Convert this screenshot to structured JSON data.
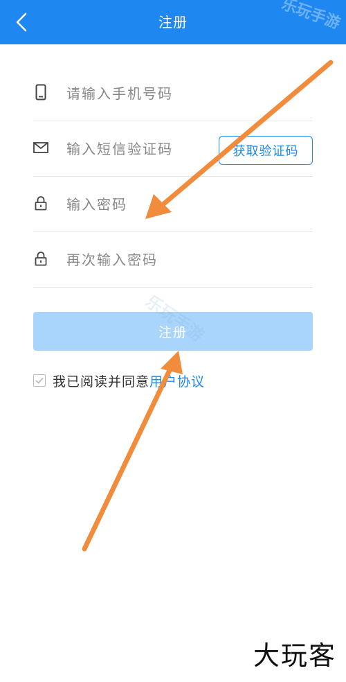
{
  "header": {
    "title": "注册",
    "watermark": "乐玩手游"
  },
  "form": {
    "phone": {
      "placeholder": "请输入手机号码",
      "icon": "phone-icon"
    },
    "sms": {
      "placeholder": "输入短信验证码",
      "icon": "mail-icon",
      "button_label": "获取验证码"
    },
    "password": {
      "placeholder": "输入密码",
      "icon": "lock-icon"
    },
    "confirm_password": {
      "placeholder": "再次输入密码",
      "icon": "lock-icon"
    }
  },
  "register_button": {
    "label": "注册"
  },
  "agreement": {
    "text": "我已阅读并同意",
    "link": "用户协议",
    "checked": true
  },
  "watermark_mid": "乐玩手游",
  "brand": "大玩客",
  "colors": {
    "primary": "#1e88f0",
    "button_disabled": "#a9d4fb",
    "arrow": "#f08c3c"
  }
}
